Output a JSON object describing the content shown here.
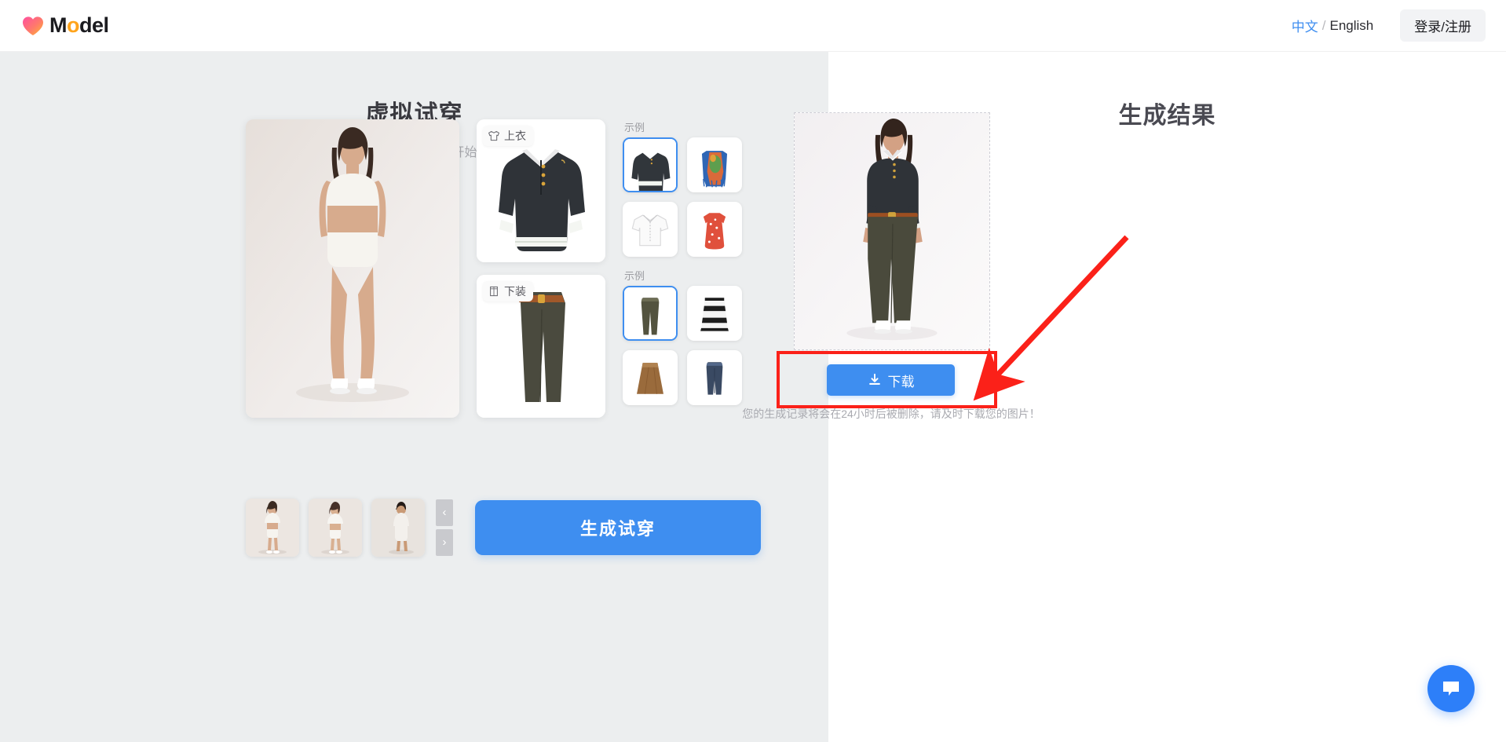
{
  "header": {
    "logo_text_left": "M",
    "logo_text_o": "o",
    "logo_text_right": "del",
    "logo_icon": "heart-icon",
    "lang_zh": "中文",
    "lang_sep": "/",
    "lang_en": "English",
    "auth_label": "登录/注册"
  },
  "left": {
    "title": "虚拟试穿",
    "subtitle": "选择一个模特并上传服装图片，开始虚拟试衣吧。",
    "top_tag": "上衣",
    "top_tag_icon": "shirt-icon",
    "bottom_tag": "下装",
    "bottom_tag_icon": "pants-icon",
    "examples_label_top": "示例",
    "examples_label_bottom": "示例",
    "top_examples": [
      {
        "name": "dark-polo-sweater",
        "selected": true
      },
      {
        "name": "floral-fringe-vest",
        "selected": false
      },
      {
        "name": "white-short-sleeve-shirt",
        "selected": false
      },
      {
        "name": "red-floral-dress",
        "selected": false
      }
    ],
    "bottom_examples": [
      {
        "name": "olive-wide-trousers",
        "selected": true
      },
      {
        "name": "black-white-stripe-skirt",
        "selected": false
      },
      {
        "name": "brown-suede-skirt",
        "selected": false
      },
      {
        "name": "blue-denim-jeans",
        "selected": false
      }
    ],
    "model_thumbs": [
      {
        "name": "model-female-1",
        "selected": true
      },
      {
        "name": "model-female-2",
        "selected": false
      },
      {
        "name": "model-male-1",
        "selected": false
      }
    ],
    "nav_prev": "‹",
    "nav_next": "›",
    "cta_label": "生成试穿"
  },
  "right": {
    "title": "生成结果",
    "download_label": "下载",
    "download_icon": "download-icon",
    "note": "您的生成记录将会在24小时后被删除，请及时下载您的图片！"
  },
  "chat": {
    "icon": "chat-bubble-icon"
  },
  "colors": {
    "accent_blue": "#3e8ef0",
    "annotation_red": "#fb2119",
    "panel_gray": "#eceeef",
    "logo_pink": "#ff5fa2",
    "logo_orange": "#ffa41c"
  }
}
